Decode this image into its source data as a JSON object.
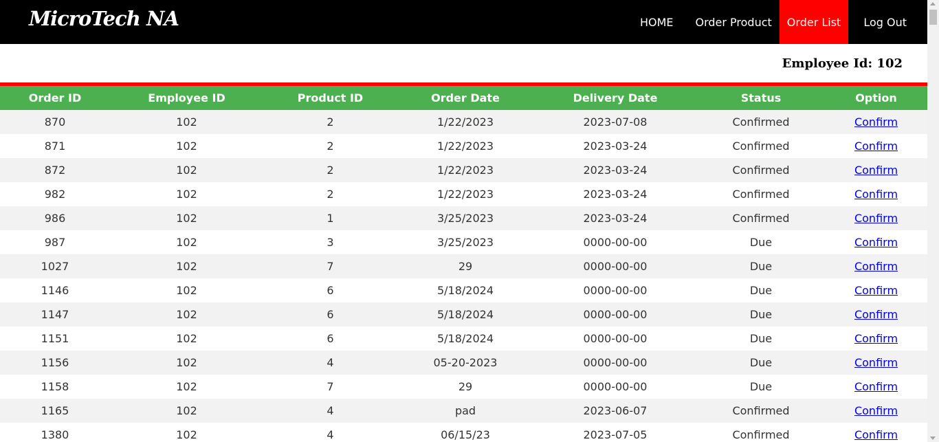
{
  "brand": "MicroTech NA",
  "nav": {
    "home": "HOME",
    "order_product": "Order Product",
    "order_list": "Order List",
    "logout": "Log Out"
  },
  "employee_id_text": "Employee Id: 102",
  "colors": {
    "nav_bg": "#000000",
    "active_tab": "#ff0000",
    "header_bg": "#4caf50",
    "accent_bar": "#ff0000"
  },
  "table": {
    "headers": [
      "Order ID",
      "Employee ID",
      "Product ID",
      "Order Date",
      "Delivery Date",
      "Status",
      "Option"
    ],
    "rows": [
      [
        "870",
        "102",
        "2",
        "1/22/2023",
        "2023-07-08",
        "Confirmed",
        "Confirm"
      ],
      [
        "871",
        "102",
        "2",
        "1/22/2023",
        "2023-03-24",
        "Confirmed",
        "Confirm"
      ],
      [
        "872",
        "102",
        "2",
        "1/22/2023",
        "2023-03-24",
        "Confirmed",
        "Confirm"
      ],
      [
        "982",
        "102",
        "2",
        "1/22/2023",
        "2023-03-24",
        "Confirmed",
        "Confirm"
      ],
      [
        "986",
        "102",
        "1",
        "3/25/2023",
        "2023-03-24",
        "Confirmed",
        "Confirm"
      ],
      [
        "987",
        "102",
        "3",
        "3/25/2023",
        "0000-00-00",
        "Due",
        "Confirm"
      ],
      [
        "1027",
        "102",
        "7",
        "29",
        "0000-00-00",
        "Due",
        "Confirm"
      ],
      [
        "1146",
        "102",
        "6",
        "5/18/2024",
        "0000-00-00",
        "Due",
        "Confirm"
      ],
      [
        "1147",
        "102",
        "6",
        "5/18/2024",
        "0000-00-00",
        "Due",
        "Confirm"
      ],
      [
        "1151",
        "102",
        "6",
        "5/18/2024",
        "0000-00-00",
        "Due",
        "Confirm"
      ],
      [
        "1156",
        "102",
        "4",
        "05-20-2023",
        "0000-00-00",
        "Due",
        "Confirm"
      ],
      [
        "1158",
        "102",
        "7",
        "29",
        "0000-00-00",
        "Due",
        "Confirm"
      ],
      [
        "1165",
        "102",
        "4",
        "pad",
        "2023-06-07",
        "Confirmed",
        "Confirm"
      ],
      [
        "1380",
        "102",
        "4",
        "06/15/23",
        "2023-07-05",
        "Confirmed",
        "Confirm"
      ]
    ]
  }
}
